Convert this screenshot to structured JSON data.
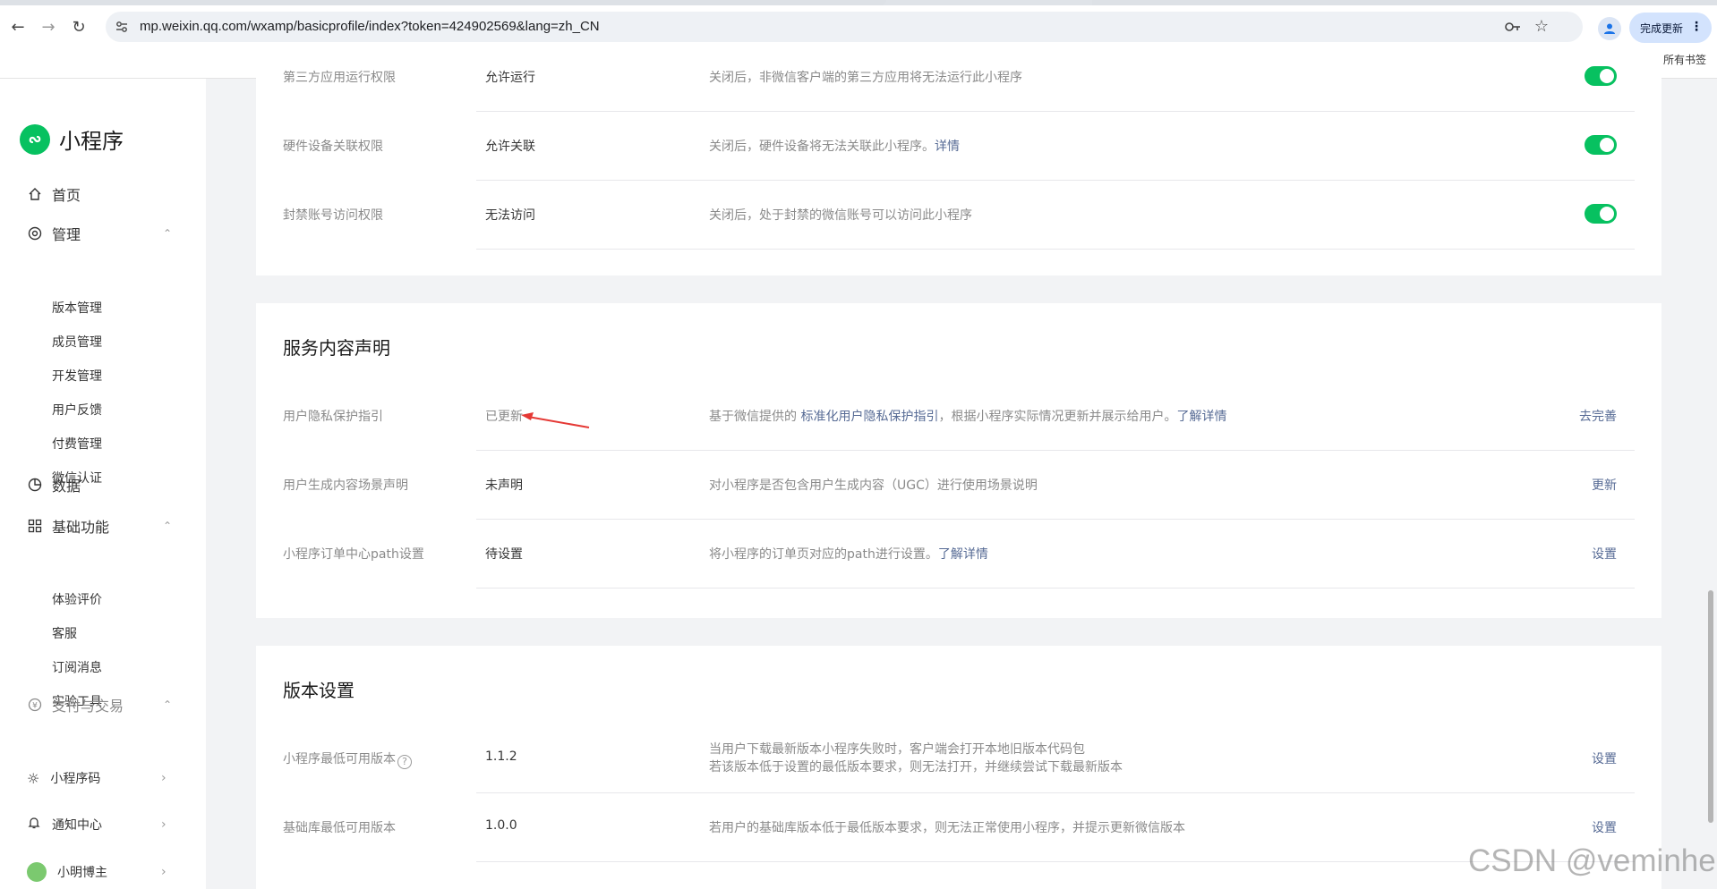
{
  "browser": {
    "url": "mp.weixin.qq.com/wxamp/basicprofile/index?token=424902569&lang=zh_CN",
    "update_button": "完成更新",
    "bookmarks_label": "所有书签"
  },
  "sidebar": {
    "app_name": "小程序",
    "home": "首页",
    "manage": "管理",
    "manage_items": [
      "版本管理",
      "成员管理",
      "开发管理",
      "用户反馈",
      "付费管理",
      "微信认证"
    ],
    "data": "数据",
    "basic": "基础功能",
    "basic_items": [
      "体验评价",
      "客服",
      "订阅消息",
      "实验工具"
    ],
    "pay": "支付与交易",
    "bottom": [
      "小程序码",
      "通知中心",
      "小明博主"
    ]
  },
  "card1": {
    "rows": [
      {
        "label": "第三方应用运行权限",
        "value": "允许运行",
        "desc": "关闭后，非微信客户端的第三方应用将无法运行此小程序"
      },
      {
        "label": "硬件设备关联权限",
        "value": "允许关联",
        "desc": "关闭后，硬件设备将无法关联此小程序。",
        "link": "详情"
      },
      {
        "label": "封禁账号访问权限",
        "value": "无法访问",
        "desc": "关闭后，处于封禁的微信账号可以访问此小程序"
      }
    ]
  },
  "card2": {
    "title": "服务内容声明",
    "row1": {
      "label": "用户隐私保护指引",
      "value": "已更新",
      "desc_a": "基于微信提供的 ",
      "desc_link": "标准化用户隐私保护指引",
      "desc_b": "，根据小程序实际情况更新并展示给用户。",
      "desc_link2": "了解详情",
      "action": "去完善"
    },
    "row2": {
      "label": "用户生成内容场景声明",
      "value": "未声明",
      "desc": "对小程序是否包含用户生成内容（UGC）进行使用场景说明",
      "action": "更新"
    },
    "row3": {
      "label": "小程序订单中心path设置",
      "value": "待设置",
      "desc": "将小程序的订单页对应的path进行设置。",
      "desc_link": "了解详情",
      "action": "设置"
    }
  },
  "card3": {
    "title": "版本设置",
    "row1": {
      "label": "小程序最低可用版本",
      "help": "?",
      "value": "1.1.2",
      "desc_line1": "当用户下载最新版本小程序失败时，客户端会打开本地旧版本代码包",
      "desc_line2": "若该版本低于设置的最低版本要求，则无法打开，并继续尝试下载最新版本",
      "action": "设置"
    },
    "row2": {
      "label": "基础库最低可用版本",
      "value": "1.0.0",
      "desc": "若用户的基础库版本低于最低版本要求，则无法正常使用小程序，并提示更新微信版本",
      "action": "设置"
    }
  },
  "watermark": "CSDN @veminhe",
  "colors": {
    "accent_green": "#07c160",
    "link_blue": "#576b95",
    "annotation_red": "#e53935"
  }
}
